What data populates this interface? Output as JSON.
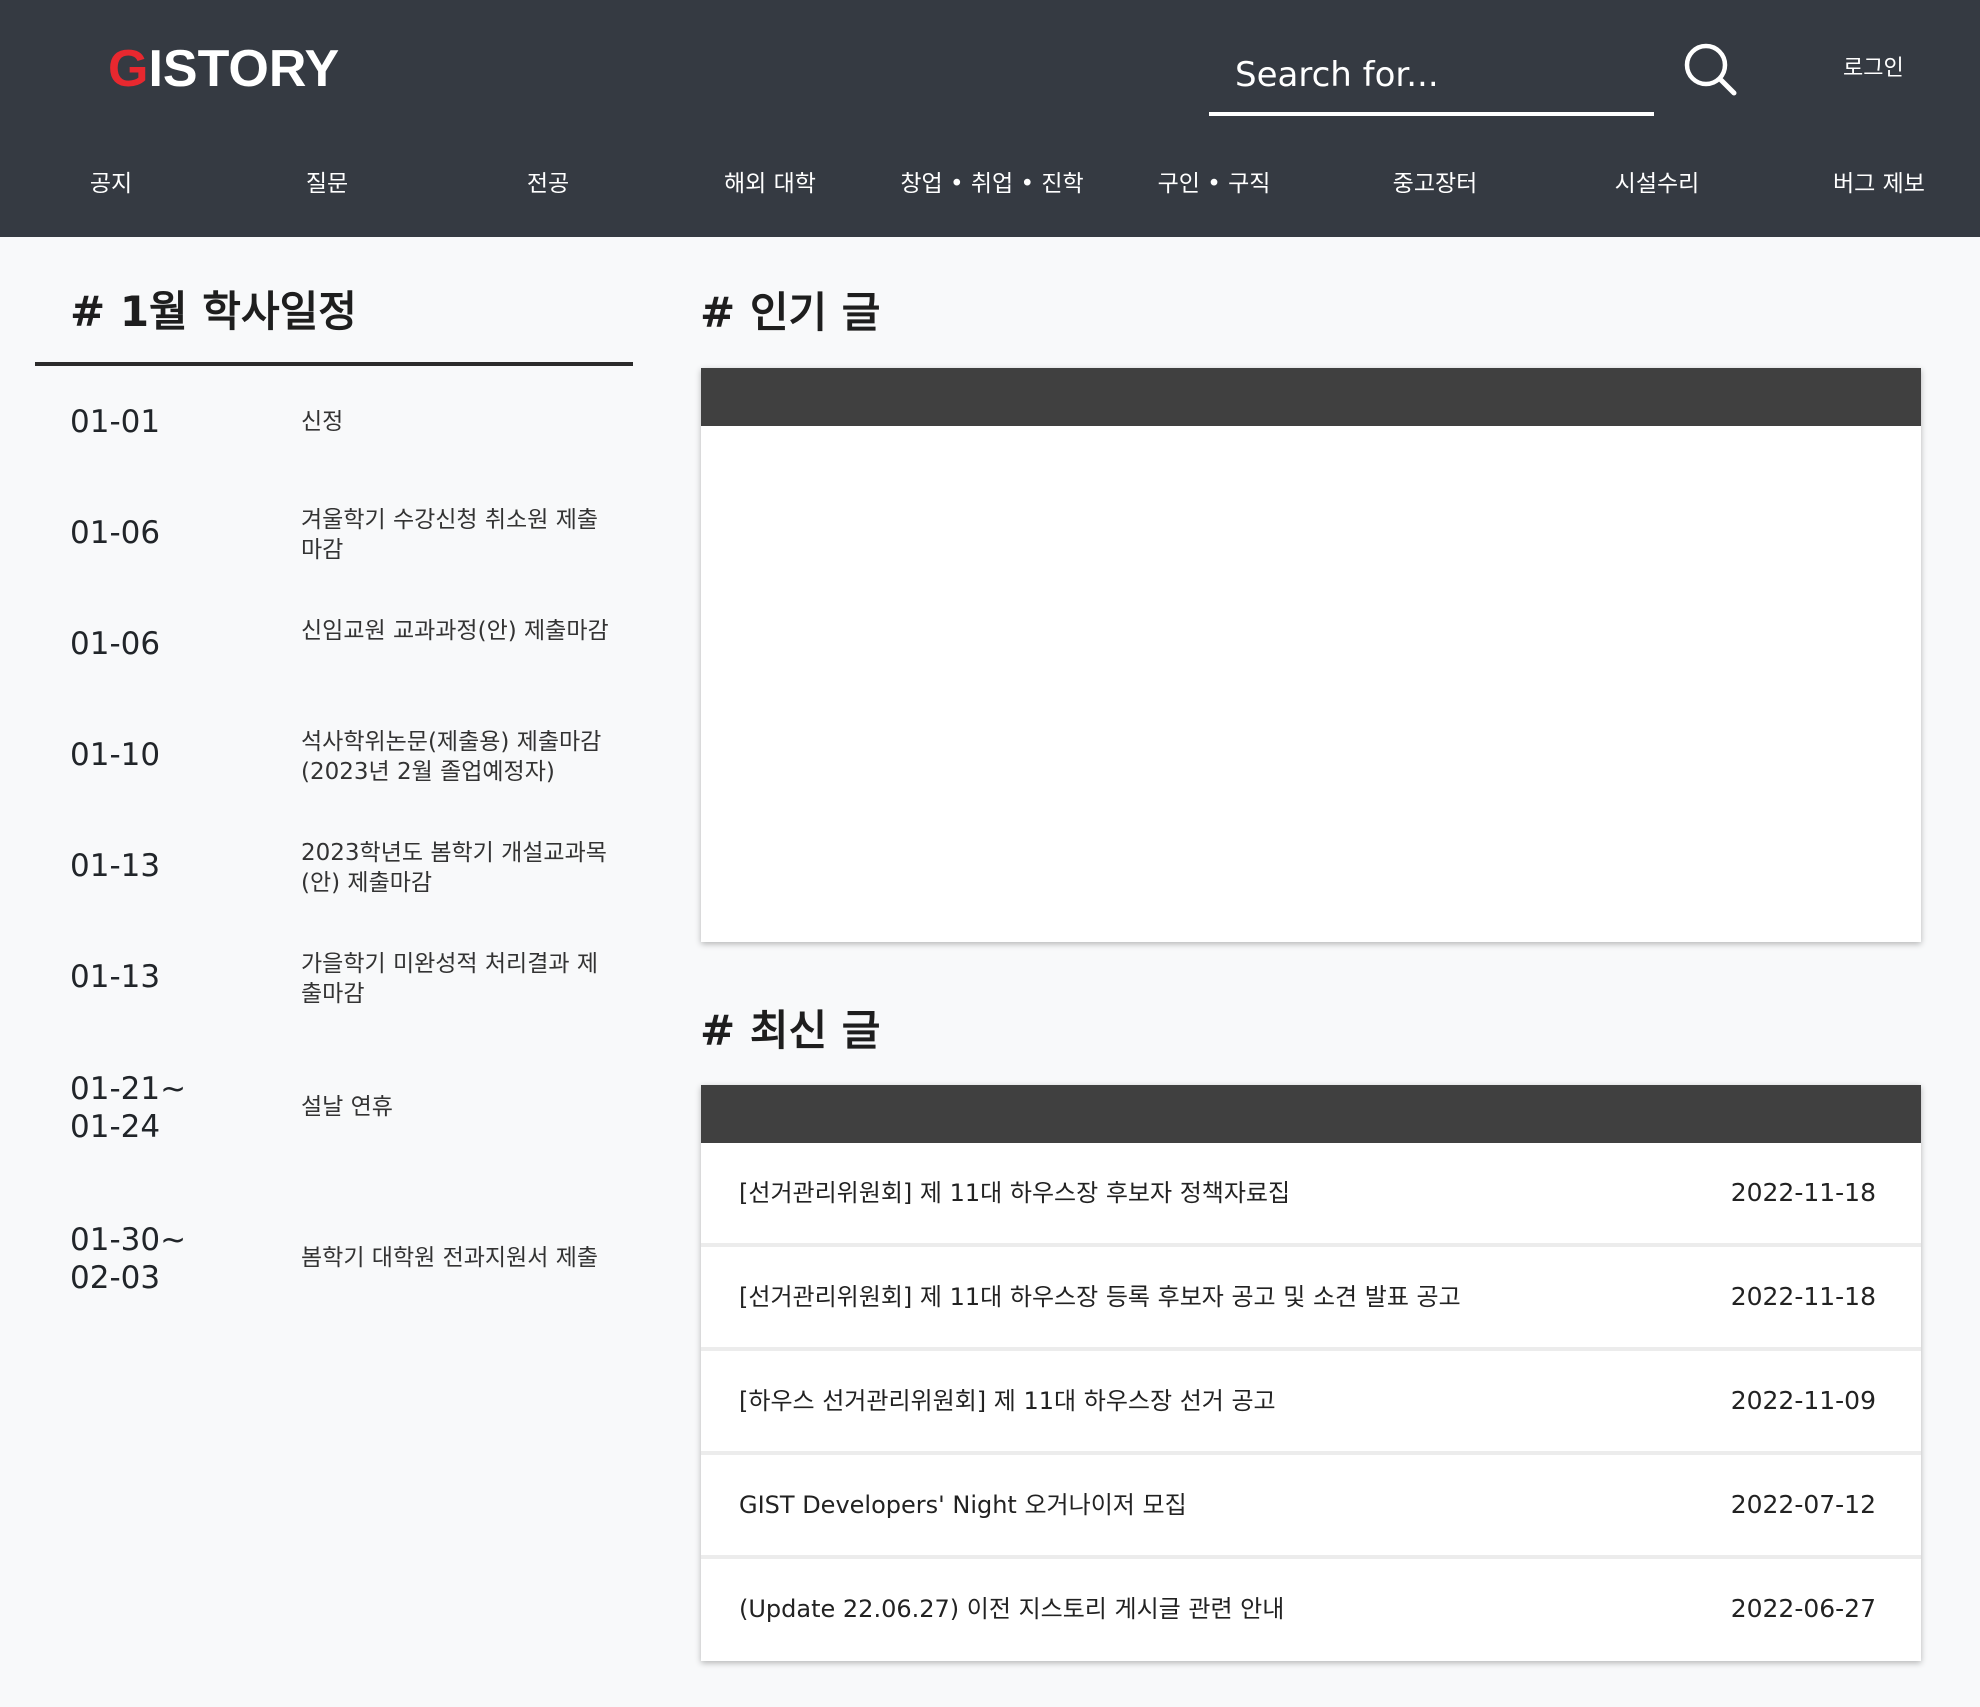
{
  "header": {
    "logo_accent": "G",
    "logo_rest": "ISTORY",
    "search_placeholder": "Search for...",
    "login_label": "로그인",
    "brand_color": "#e8282f",
    "background": "#353a42"
  },
  "nav": [
    {
      "label": "공지"
    },
    {
      "label": "질문"
    },
    {
      "label": "전공"
    },
    {
      "label": "해외 대학"
    },
    {
      "label": "창업 • 취업 • 진학"
    },
    {
      "label": "구인 • 구직"
    },
    {
      "label": "중고장터"
    },
    {
      "label": "시설수리"
    },
    {
      "label": "버그 제보"
    }
  ],
  "schedule": {
    "title": "# 1월 학사일정",
    "items": [
      {
        "date": "01-01",
        "desc": "신정"
      },
      {
        "date": "01-06",
        "desc": "겨울학기 수강신청 취소원 제출마감"
      },
      {
        "date": "01-06",
        "desc": "신임교원 교과과정(안) 제출마감"
      },
      {
        "date": "01-10",
        "desc": "석사학위논문(제출용) 제출마감 (2023년 2월 졸업예정자)"
      },
      {
        "date": "01-13",
        "desc": "2023학년도 봄학기 개설교과목(안) 제출마감"
      },
      {
        "date": "01-13",
        "desc": "가을학기 미완성적 처리결과 제출마감"
      },
      {
        "date": "01-21~\n01-24",
        "desc": "설날 연휴"
      },
      {
        "date": "01-30~\n02-03",
        "desc": "봄학기 대학원 전과지원서 제출"
      }
    ]
  },
  "popular": {
    "title": "# 인기 글",
    "posts": []
  },
  "recent": {
    "title": "# 최신 글",
    "posts": [
      {
        "title": "[선거관리위원회] 제 11대 하우스장 후보자 정책자료집",
        "date": "2022-11-18"
      },
      {
        "title": "[선거관리위원회] 제 11대 하우스장 등록 후보자 공고 및 소견 발표 공고",
        "date": "2022-11-18"
      },
      {
        "title": "[하우스 선거관리위원회] 제 11대 하우스장 선거 공고",
        "date": "2022-11-09"
      },
      {
        "title": "GIST Developers' Night 오거나이저 모집",
        "date": "2022-07-12"
      },
      {
        "title": "(Update 22.06.27) 이전 지스토리 게시글 관련 안내",
        "date": "2022-06-27"
      }
    ]
  }
}
